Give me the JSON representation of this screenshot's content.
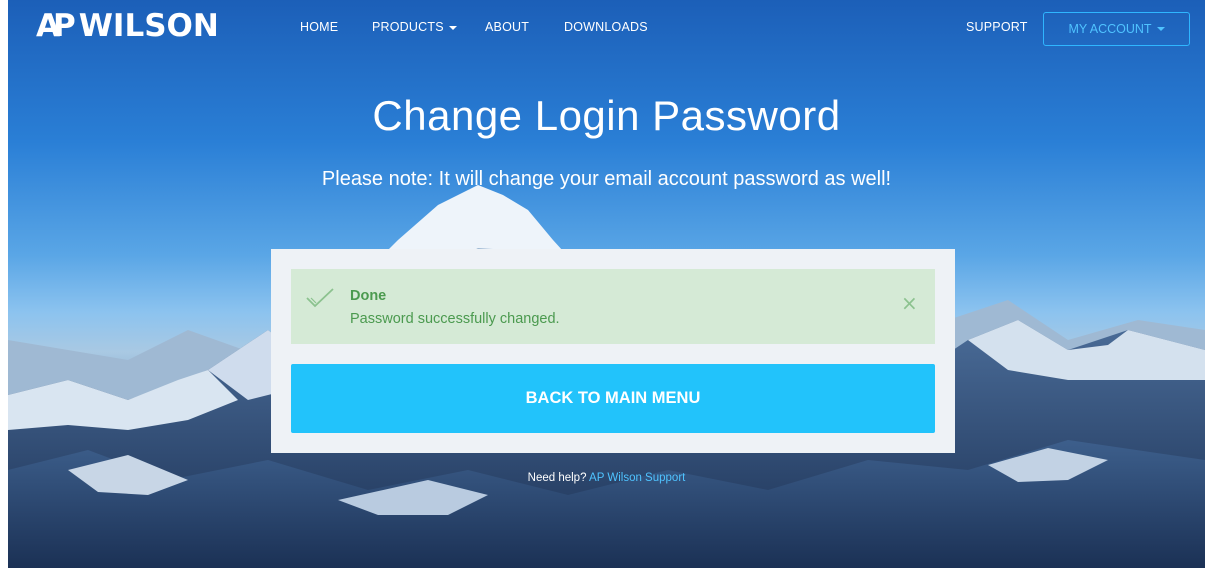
{
  "brand": {
    "logo_left": "AP",
    "logo_right": "WILSON"
  },
  "nav": {
    "home": "HOME",
    "products": "PRODUCTS",
    "about": "ABOUT",
    "downloads": "DOWNLOADS",
    "support": "SUPPORT",
    "my_account": "MY ACCOUNT"
  },
  "page": {
    "title": "Change Login Password",
    "note": "Please note: It will change your email account password as well!"
  },
  "alert": {
    "icon": "checkmark-icon",
    "title": "Done",
    "message": "Password successfully changed.",
    "close_icon": "close-icon",
    "close_glyph": "×"
  },
  "actions": {
    "back_label": "BACK TO MAIN MENU"
  },
  "footer": {
    "help_text": "Need help?",
    "help_link": "AP Wilson Support"
  },
  "colors": {
    "accent": "#22c3fb",
    "success_bg": "#d5ead6",
    "success_text": "#4b9a4f",
    "panel_bg": "#eef2f6"
  }
}
